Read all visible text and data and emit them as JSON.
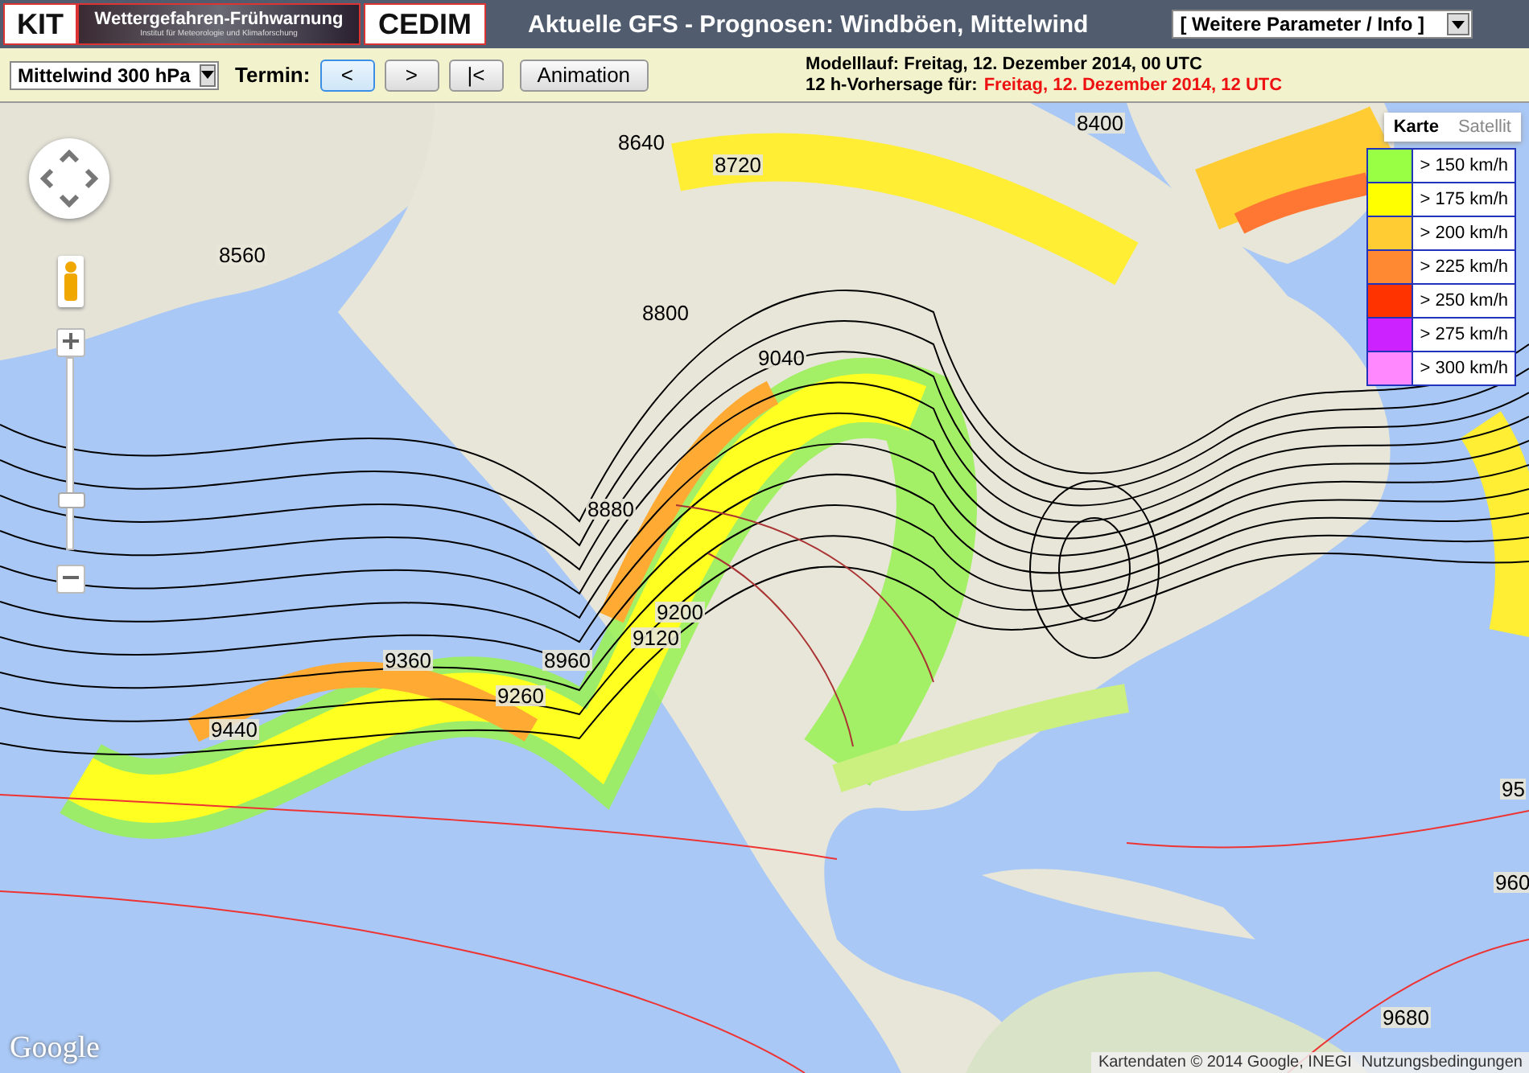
{
  "header": {
    "logo_left": "KIT",
    "banner_title": "Wettergefahren-Frühwarnung",
    "banner_subtitle": "Institut für Meteorologie und Klimaforschung",
    "logo_right": "CEDIM",
    "title": "Aktuelle GFS - Prognosen: Windböen, Mittelwind",
    "parameter_select": "[ Weitere Parameter / Info ]"
  },
  "toolbar": {
    "level_select": "Mittelwind 300 hPa",
    "termin_label": "Termin:",
    "buttons": [
      {
        "label": "<",
        "selected": true
      },
      {
        "label": ">",
        "selected": false
      },
      {
        "label": "|<",
        "selected": false
      }
    ],
    "animation_button": "Animation",
    "model_run": "Modelllauf: Freitag, 12. Dezember 2014, 00 UTC",
    "forecast_label": "12 h-Vorhersage für:",
    "forecast_time": "Freitag, 12. Dezember 2014, 12 UTC"
  },
  "map": {
    "map_types": [
      {
        "label": "Karte",
        "selected": true
      },
      {
        "label": "Satellit",
        "selected": false
      }
    ],
    "zoom": {
      "level": 0.26
    },
    "legend": [
      {
        "label": "> 150 km/h",
        "color": "#99ff44"
      },
      {
        "label": "> 175 km/h",
        "color": "#ffff00"
      },
      {
        "label": "> 200 km/h",
        "color": "#ffcc33"
      },
      {
        "label": "> 225 km/h",
        "color": "#ff8833"
      },
      {
        "label": "> 250 km/h",
        "color": "#ff3300"
      },
      {
        "label": "> 275 km/h",
        "color": "#cc22ff"
      },
      {
        "label": "> 300 km/h",
        "color": "#ff88ff"
      }
    ],
    "contour_labels": [
      "8640",
      "8720",
      "8400",
      "8560",
      "8800",
      "9040",
      "8880",
      "9200",
      "9120",
      "8960",
      "9360",
      "9260",
      "9440",
      "9680",
      "960",
      "95"
    ],
    "google_logo": "Google",
    "attribution": "Kartendaten © 2014 Google, INEGI",
    "terms_link": "Nutzungsbedingungen"
  }
}
